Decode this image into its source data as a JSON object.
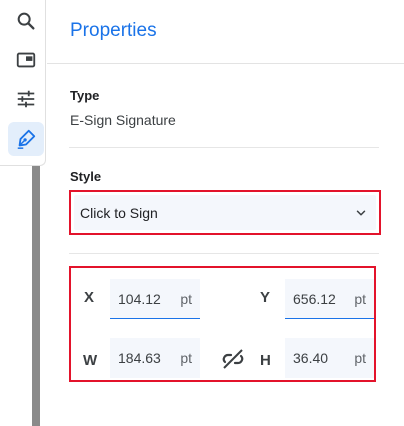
{
  "toolbar": {
    "tools": [
      {
        "icon": "search-icon"
      },
      {
        "icon": "window-icon"
      },
      {
        "icon": "sliders-icon"
      },
      {
        "icon": "pen-icon",
        "active": true
      }
    ]
  },
  "panel": {
    "title": "Properties",
    "type_label": "Type",
    "type_value": "E-Sign Signature",
    "style_label": "Style",
    "style_value": "Click to Sign"
  },
  "geometry": {
    "x_label": "X",
    "x_value": "104.12",
    "x_unit": "pt",
    "y_label": "Y",
    "y_value": "656.12",
    "y_unit": "pt",
    "w_label": "W",
    "w_value": "184.63",
    "w_unit": "pt",
    "h_label": "H",
    "h_value": "36.40",
    "h_unit": "pt"
  },
  "colors": {
    "accent": "#1a73e8",
    "highlight_border": "#e3132b",
    "field_bg": "#f4f7fc"
  }
}
